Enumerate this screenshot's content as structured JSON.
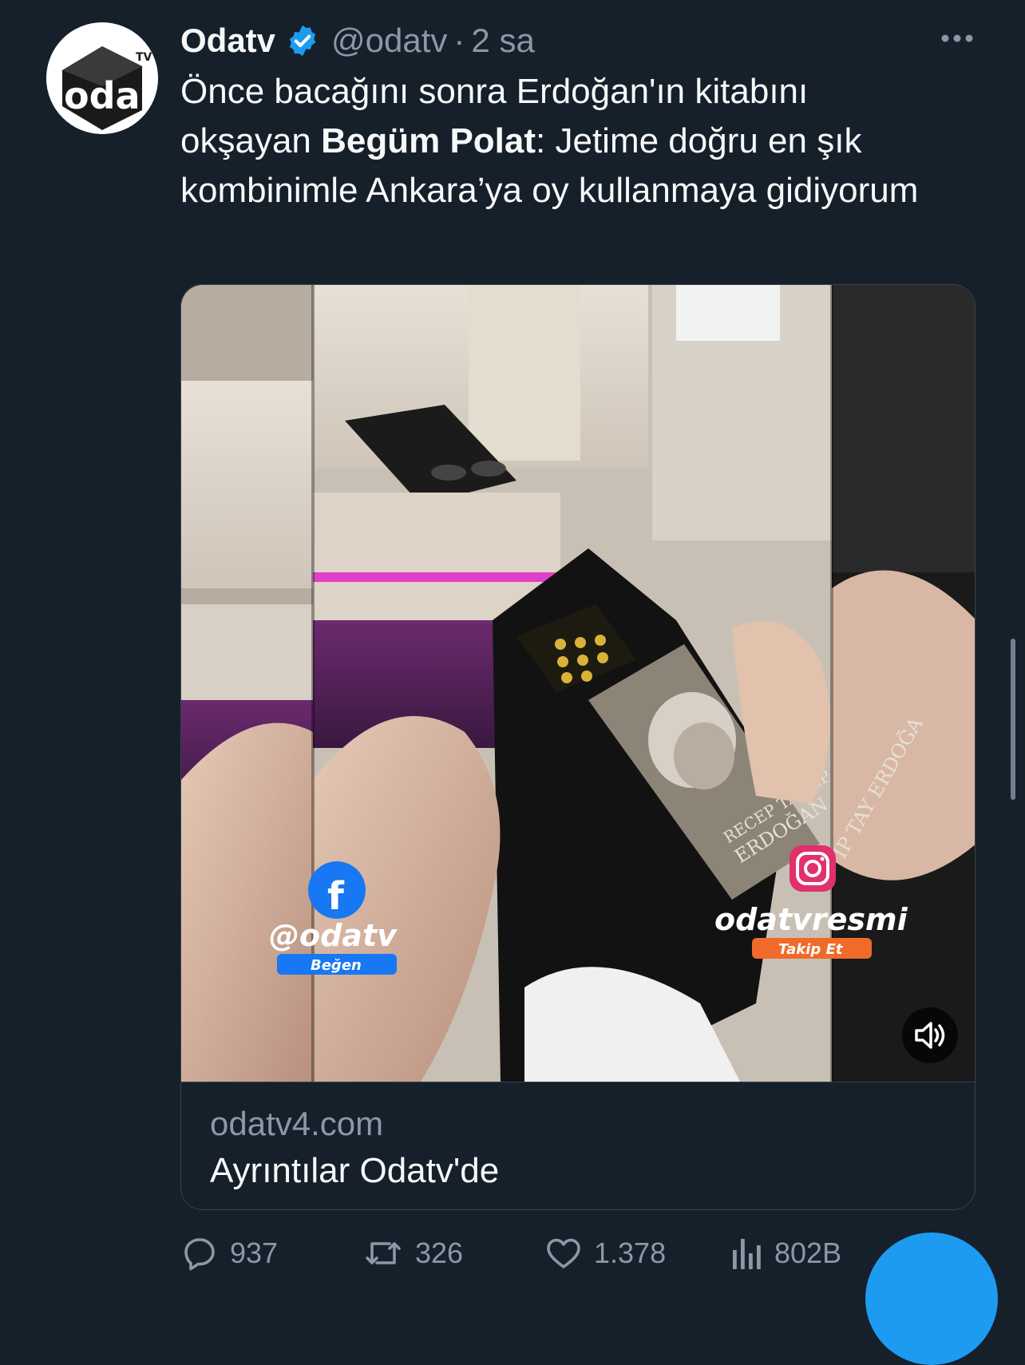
{
  "tweet": {
    "author_name": "Odatv",
    "author_handle": "@odatv",
    "separator": "·",
    "time": "2 sa",
    "text_part1": "Önce bacağını sonra Erdoğan'ın kitabını okşayan ",
    "text_bold": "Begüm Polat",
    "text_part2": ": Jetime doğru en şık kombinimle Ankara’ya oy kullanmaya gidiyorum"
  },
  "card": {
    "domain": "odatv4.com",
    "title": "Ayrıntılar Odatv'de",
    "overlay": {
      "facebook_handle": "@odatv",
      "facebook_action": "Beğen",
      "instagram_handle": "odatvresmi",
      "instagram_action": "Takip Et",
      "book_author_line1": "RECEP TAYYİP",
      "book_author_line2": "ERDOĞAN",
      "book_spine": "İP TAY ERDOĞA"
    }
  },
  "actions": {
    "replies": "937",
    "retweets": "326",
    "likes": "1.378",
    "views": "802B"
  },
  "avatar": {
    "logo_text": "oda",
    "superscript": "TV"
  },
  "colors": {
    "background": "#15202b",
    "accent": "#1d9bf0",
    "muted": "#8b98a5",
    "text": "#f7f9f9"
  },
  "icons": [
    "verified-badge-icon",
    "more-options-icon",
    "speaker-icon",
    "reply-icon",
    "retweet-icon",
    "like-icon",
    "views-icon",
    "facebook-icon",
    "instagram-icon"
  ]
}
